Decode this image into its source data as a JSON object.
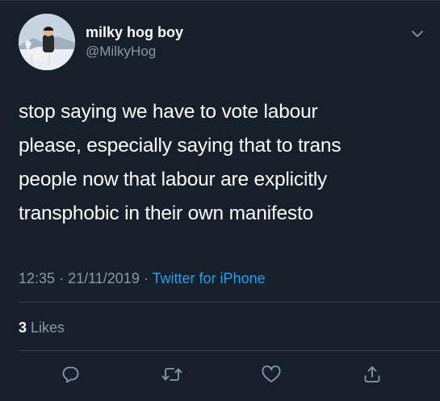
{
  "author": {
    "display_name": "milky hog boy",
    "handle": "@MilkyHog",
    "avatar_icon": "avatar-photo"
  },
  "tweet": {
    "lines": [
      "stop saying we have to vote labour",
      "please, especially saying that to trans",
      "people now that labour are explicitly",
      "transphobic in their own manifesto"
    ]
  },
  "meta": {
    "time": "12:35",
    "separator": "·",
    "date": "21/11/2019",
    "source": "Twitter for iPhone"
  },
  "stats": {
    "likes_count": "3",
    "likes_label": "Likes"
  },
  "actions": {
    "reply_icon": "reply-icon",
    "retweet_icon": "retweet-icon",
    "like_icon": "heart-icon",
    "share_icon": "share-icon"
  },
  "colors": {
    "background": "#15202b",
    "secondary_text": "#8899a6",
    "accent": "#1da1f2",
    "divider": "#38444d"
  }
}
